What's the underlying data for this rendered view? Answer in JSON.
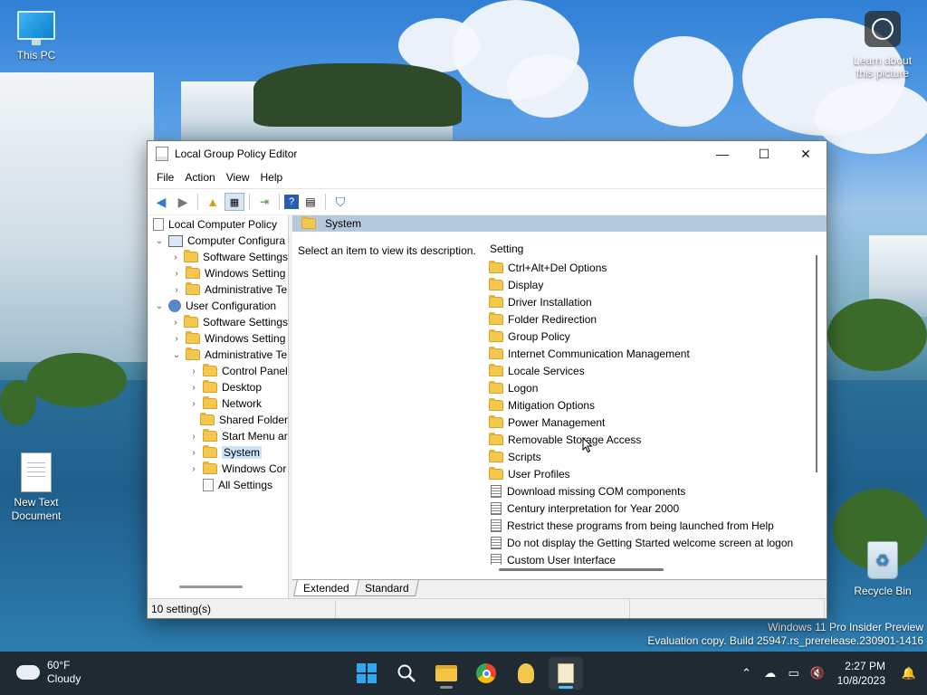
{
  "desktop": {
    "icons": [
      {
        "label": "This PC"
      },
      {
        "label": "Learn about this picture"
      },
      {
        "label": "New Text Document"
      },
      {
        "label": "Recycle Bin"
      }
    ],
    "watermark": {
      "line1": "Windows 11 Pro Insider Preview",
      "line2": "Evaluation copy. Build 25947.rs_prerelease.230901-1416"
    }
  },
  "window": {
    "title": "Local Group Policy Editor",
    "controls": {
      "minimize": "—",
      "maximize": "☐",
      "close": "✕"
    },
    "menu": [
      "File",
      "Action",
      "View",
      "Help"
    ],
    "tree": {
      "root": "Local Computer Policy",
      "items": [
        {
          "label": "Computer Configura",
          "indent": 0,
          "twisty": "expanded",
          "icon": "computer"
        },
        {
          "label": "Software Settings",
          "indent": 1,
          "twisty": "collapsed",
          "icon": "folder"
        },
        {
          "label": "Windows Setting",
          "indent": 1,
          "twisty": "collapsed",
          "icon": "folder"
        },
        {
          "label": "Administrative Te",
          "indent": 1,
          "twisty": "collapsed",
          "icon": "folder"
        },
        {
          "label": "User Configuration",
          "indent": 0,
          "twisty": "expanded",
          "icon": "user"
        },
        {
          "label": "Software Settings",
          "indent": 1,
          "twisty": "collapsed",
          "icon": "folder"
        },
        {
          "label": "Windows Setting",
          "indent": 1,
          "twisty": "collapsed",
          "icon": "folder"
        },
        {
          "label": "Administrative Te",
          "indent": 1,
          "twisty": "expanded",
          "icon": "folder"
        },
        {
          "label": "Control Panel",
          "indent": 2,
          "twisty": "collapsed",
          "icon": "folder"
        },
        {
          "label": "Desktop",
          "indent": 2,
          "twisty": "collapsed",
          "icon": "folder"
        },
        {
          "label": "Network",
          "indent": 2,
          "twisty": "collapsed",
          "icon": "folder"
        },
        {
          "label": "Shared Folder",
          "indent": 2,
          "twisty": "none",
          "icon": "folder"
        },
        {
          "label": "Start Menu ar",
          "indent": 2,
          "twisty": "collapsed",
          "icon": "folder"
        },
        {
          "label": "System",
          "indent": 2,
          "twisty": "collapsed",
          "icon": "folder",
          "selected": true
        },
        {
          "label": "Windows Cor",
          "indent": 2,
          "twisty": "collapsed",
          "icon": "folder"
        },
        {
          "label": "All Settings",
          "indent": 2,
          "twisty": "none",
          "icon": "doc"
        }
      ]
    },
    "right": {
      "header": "System",
      "description": "Select an item to view its description.",
      "column_header": "Setting",
      "folders": [
        "Ctrl+Alt+Del Options",
        "Display",
        "Driver Installation",
        "Folder Redirection",
        "Group Policy",
        "Internet Communication Management",
        "Locale Services",
        "Logon",
        "Mitigation Options",
        "Power Management",
        "Removable Storage Access",
        "Scripts",
        "User Profiles"
      ],
      "settings": [
        "Download missing COM components",
        "Century interpretation for Year 2000",
        "Restrict these programs from being launched from Help",
        "Do not display the Getting Started welcome screen at logon",
        "Custom User Interface"
      ],
      "tabs": [
        "Extended",
        "Standard"
      ]
    },
    "status": "10 setting(s)"
  },
  "taskbar": {
    "weather_temp": "60°F",
    "weather_desc": "Cloudy",
    "time": "2:27 PM",
    "date": "10/8/2023"
  }
}
